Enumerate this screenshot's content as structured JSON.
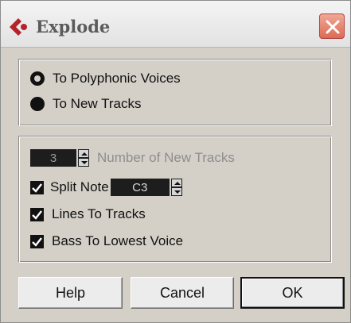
{
  "window": {
    "title": "Explode",
    "close_symbol": "close-icon"
  },
  "mode_group": {
    "options": [
      {
        "label": "To Polyphonic Voices",
        "selected": false
      },
      {
        "label": "To New Tracks",
        "selected": true
      }
    ]
  },
  "options_group": {
    "number_of_tracks": {
      "value": "3",
      "label": "Number of New Tracks",
      "enabled": false
    },
    "split_note": {
      "label": "Split Note",
      "checked": true,
      "value": "C3"
    },
    "lines_to_tracks": {
      "label": "Lines To Tracks",
      "checked": true
    },
    "bass_to_lowest_voice": {
      "label": "Bass To Lowest Voice",
      "checked": true
    }
  },
  "buttons": {
    "help": "Help",
    "cancel": "Cancel",
    "ok": "OK"
  },
  "colors": {
    "accent_logo": "#b4232a",
    "dialog_bg": "#d4d0c8",
    "close_button": "#dc6b54"
  }
}
